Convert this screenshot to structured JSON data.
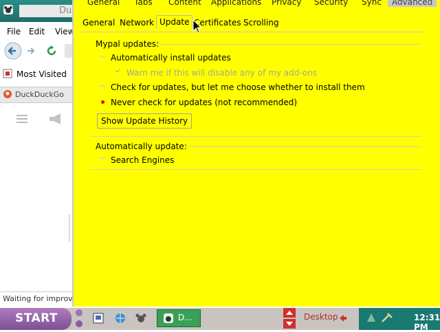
{
  "browser": {
    "title": "Du",
    "menu": {
      "file": "File",
      "edit": "Edit",
      "view": "View"
    },
    "bookmark": "Most Visited",
    "tab_title": "DuckDuckGo",
    "status": "Waiting for improv"
  },
  "dialog": {
    "main_tabs": [
      "General",
      "Tabs",
      "Content",
      "Applications",
      "Privacy",
      "Security",
      "Sync",
      "Advanced"
    ],
    "active_main_tab": "Advanced",
    "sub_tabs": [
      "General",
      "Network",
      "Update",
      "Certificates",
      "Scrolling"
    ],
    "active_sub_tab": "Update",
    "mypal_updates": {
      "label": "Mypal updates:",
      "auto_install": "Automatically install updates",
      "warn_addons": "Warn me if this will disable any of my add-ons",
      "check_choose": "Check for updates, but let me choose whether to install them",
      "never_check": "Never check for updates (not recommended)",
      "selected": "never_check",
      "history_button": "Show Update History"
    },
    "auto_update": {
      "label": "Automatically update:",
      "search_engines": "Search Engines"
    }
  },
  "taskbar": {
    "start_label": "START",
    "task_label": "D...",
    "desktop_label": "Desktop",
    "clock": "12:31 PM"
  },
  "colors": {
    "dialog_bg": "#ffff00",
    "radio_selected": "#e00000",
    "taskbar_clock_bg": "#1a7a72"
  }
}
